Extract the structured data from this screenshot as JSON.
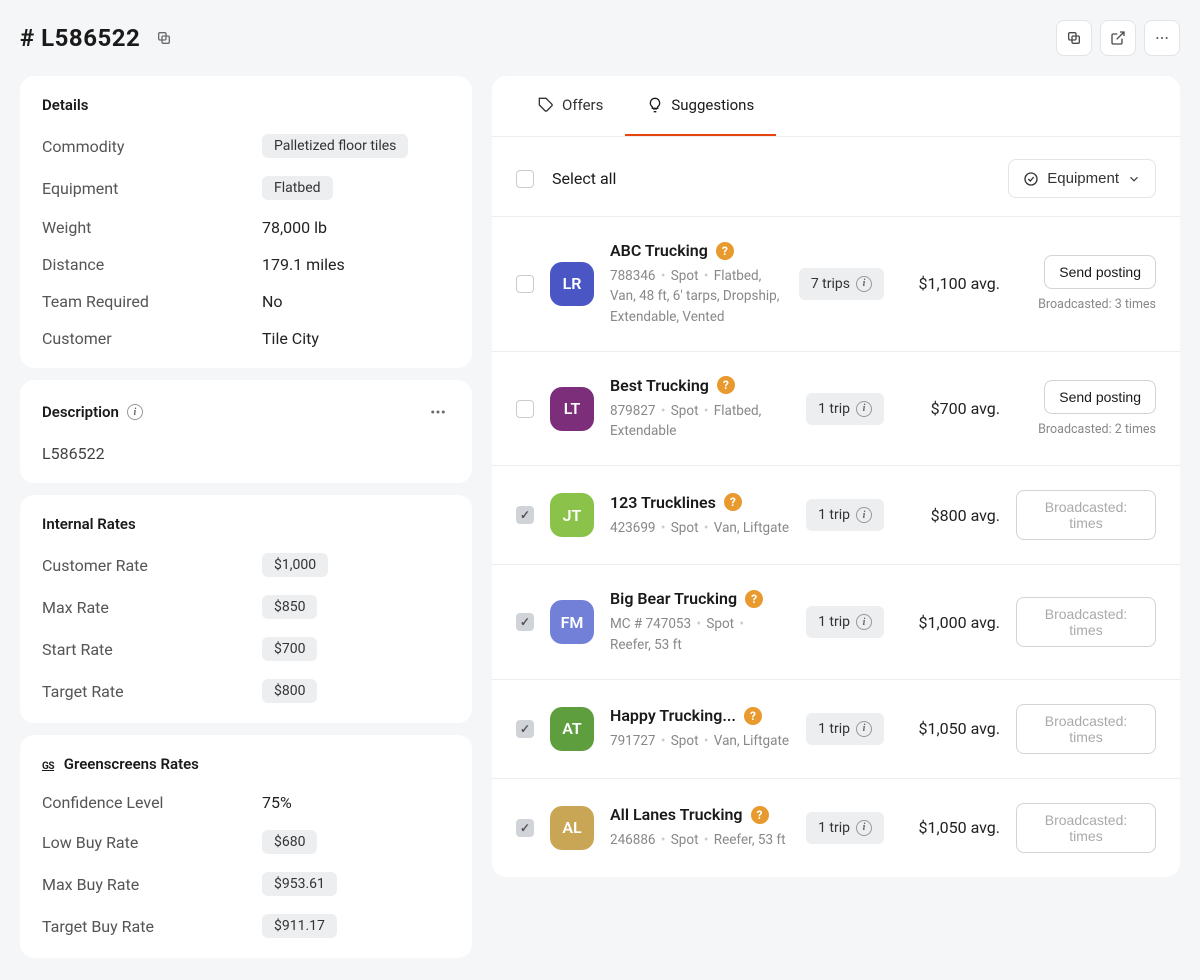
{
  "header": {
    "title": "# L586522"
  },
  "details": {
    "title": "Details",
    "commodity_label": "Commodity",
    "commodity_value": "Palletized floor tiles",
    "equipment_label": "Equipment",
    "equipment_value": "Flatbed",
    "weight_label": "Weight",
    "weight_value": "78,000 lb",
    "distance_label": "Distance",
    "distance_value": "179.1 miles",
    "team_label": "Team Required",
    "team_value": "No",
    "customer_label": "Customer",
    "customer_value": "Tile City"
  },
  "description": {
    "title": "Description",
    "value": "L586522"
  },
  "internal_rates": {
    "title": "Internal Rates",
    "customer_rate_label": "Customer Rate",
    "customer_rate_value": "$1,000",
    "max_rate_label": "Max Rate",
    "max_rate_value": "$850",
    "start_rate_label": "Start Rate",
    "start_rate_value": "$700",
    "target_rate_label": "Target Rate",
    "target_rate_value": "$800"
  },
  "greenscreens": {
    "prefix": "GS",
    "title": "Greenscreens Rates",
    "confidence_label": "Confidence Level",
    "confidence_value": "75%",
    "low_buy_label": "Low Buy Rate",
    "low_buy_value": "$680",
    "max_buy_label": "Max Buy Rate",
    "max_buy_value": "$953.61",
    "target_buy_label": "Target Buy Rate",
    "target_buy_value": "$911.17"
  },
  "tabs": {
    "offers": "Offers",
    "suggestions": "Suggestions"
  },
  "list": {
    "select_all_label": "Select all",
    "filter_label": "Equipment"
  },
  "carriers": [
    {
      "avatar": "LR",
      "avatar_color": "#4a56c4",
      "name": "ABC Trucking",
      "checked": false,
      "meta": "788346 • Spot • Flatbed, Van, 48 ft, 6' tarps, Dropship, Extendable, Vented",
      "trips": "7 trips",
      "avg": "$1,100 avg.",
      "action": "Send posting",
      "action_disabled": false,
      "broadcasted": "Broadcasted: 3 times"
    },
    {
      "avatar": "LT",
      "avatar_color": "#7d2e7a",
      "name": "Best Trucking",
      "checked": false,
      "meta": "879827 • Spot • Flatbed, Extendable",
      "trips": "1 trip",
      "avg": "$700 avg.",
      "action": "Send posting",
      "action_disabled": false,
      "broadcasted": "Broadcasted: 2 times"
    },
    {
      "avatar": "JT",
      "avatar_color": "#8bc34a",
      "name": "123 Trucklines",
      "checked": true,
      "meta": "423699 • Spot • Van, Liftgate",
      "trips": "1 trip",
      "avg": "$800 avg.",
      "action": "Broadcasted: times",
      "action_disabled": true,
      "broadcasted": ""
    },
    {
      "avatar": "FM",
      "avatar_color": "#7280d8",
      "name": "Big Bear Trucking",
      "checked": true,
      "meta": "MC # 747053 • Spot • Reefer, 53 ft",
      "trips": "1 trip",
      "avg": "$1,000 avg.",
      "action": "Broadcasted: times",
      "action_disabled": true,
      "broadcasted": ""
    },
    {
      "avatar": "AT",
      "avatar_color": "#5f9e3e",
      "name": "Happy Trucking...",
      "checked": true,
      "meta": "791727 • Spot • Van, Liftgate",
      "trips": "1 trip",
      "avg": "$1,050 avg.",
      "action": "Broadcasted: times",
      "action_disabled": true,
      "broadcasted": ""
    },
    {
      "avatar": "AL",
      "avatar_color": "#c9a656",
      "name": "All Lanes Trucking",
      "checked": true,
      "meta": "246886 • Spot • Reefer, 53 ft",
      "trips": "1 trip",
      "avg": "$1,050 avg.",
      "action": "Broadcasted: times",
      "action_disabled": true,
      "broadcasted": ""
    }
  ]
}
